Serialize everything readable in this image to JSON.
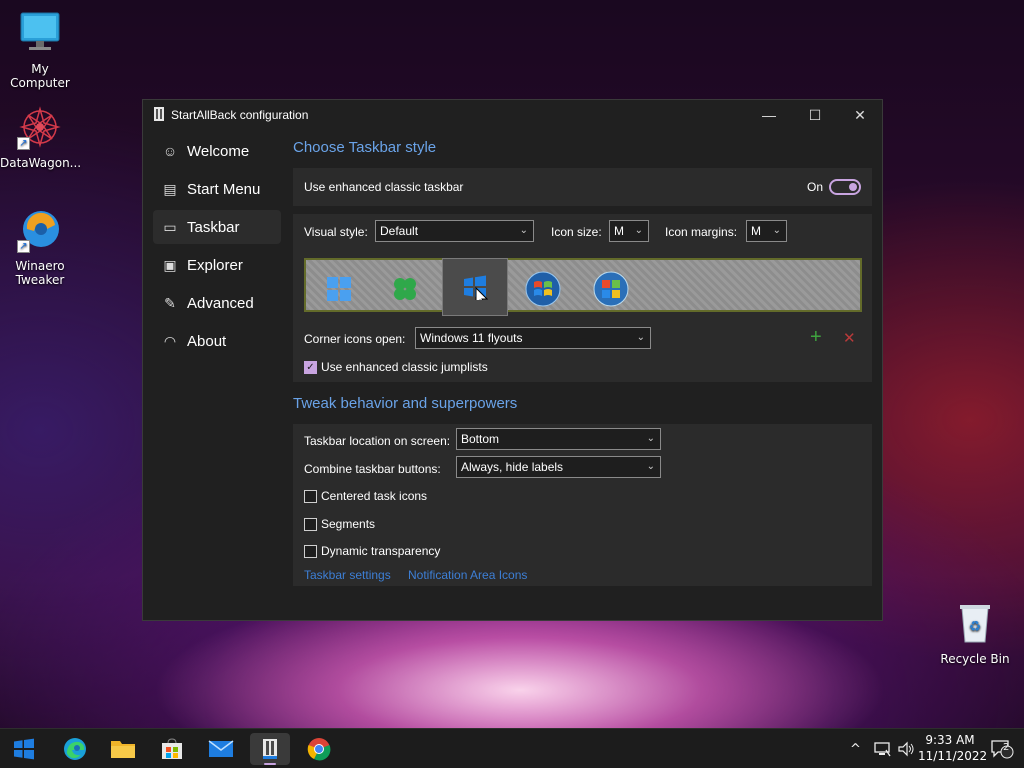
{
  "desktop": {
    "icons": [
      {
        "label": "My Computer",
        "icon": "monitor-icon"
      },
      {
        "label": "DataWagon...",
        "icon": "datawagon-icon"
      },
      {
        "label": "Winaero Tweaker",
        "icon": "winaero-icon"
      },
      {
        "label": "Recycle Bin",
        "icon": "recycle-bin-icon"
      }
    ]
  },
  "window": {
    "title": "StartAllBack configuration",
    "controls": {
      "minimize": "—",
      "maximize": "☐",
      "close": "✕"
    }
  },
  "nav": {
    "items": [
      {
        "label": "Welcome",
        "icon": "smile-icon",
        "glyph": "☺"
      },
      {
        "label": "Start Menu",
        "icon": "start-menu-icon",
        "glyph": "▤"
      },
      {
        "label": "Taskbar",
        "icon": "taskbar-icon",
        "glyph": "▭"
      },
      {
        "label": "Explorer",
        "icon": "explorer-icon",
        "glyph": "▣"
      },
      {
        "label": "Advanced",
        "icon": "wrench-icon",
        "glyph": "✎"
      },
      {
        "label": "About",
        "icon": "gauge-icon",
        "glyph": "◠"
      }
    ],
    "active": "Taskbar"
  },
  "taskbar_style": {
    "heading": "Choose Taskbar style",
    "enhanced_label": "Use enhanced classic taskbar",
    "enhanced_state": "On",
    "visual_style_label": "Visual style:",
    "visual_style_value": "Default",
    "icon_size_label": "Icon size:",
    "icon_size_value": "M",
    "icon_margins_label": "Icon margins:",
    "icon_margins_value": "M",
    "corner_icons_label": "Corner icons open:",
    "corner_icons_value": "Windows 11 flyouts",
    "jumplists_label": "Use enhanced classic jumplists",
    "jumplists_checked": true,
    "add_glyph": "+",
    "remove_glyph": "✕"
  },
  "tweaks": {
    "heading": "Tweak behavior and superpowers",
    "location_label": "Taskbar location on screen:",
    "location_value": "Bottom",
    "combine_label": "Combine taskbar buttons:",
    "combine_value": "Always, hide labels",
    "centered_label": "Centered task icons",
    "segments_label": "Segments",
    "transparency_label": "Dynamic transparency",
    "link_taskbar_settings": "Taskbar settings",
    "link_notification_icons": "Notification Area Icons"
  },
  "taskbar": {
    "time": "9:33 AM",
    "date": "11/11/2022",
    "notification_count": "2",
    "chevron": "^"
  },
  "colors": {
    "accent": "#c8a4e0",
    "heading": "#6aa3e8",
    "link": "#3d7fd6",
    "add_green": "#3fa33f",
    "remove_red": "#b83a3a"
  }
}
